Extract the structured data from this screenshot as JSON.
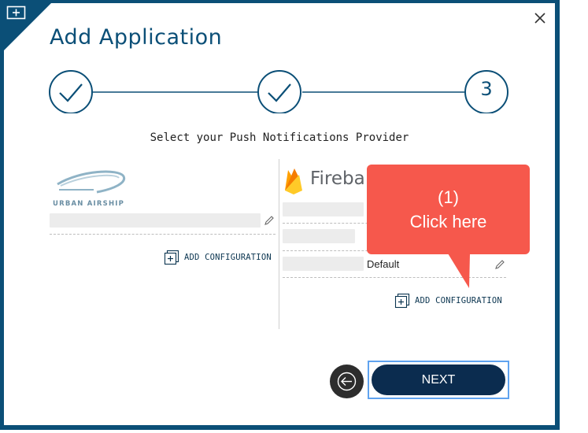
{
  "dialog": {
    "title": "Add Application",
    "close_icon": "close-icon",
    "corner_icon": "new-window-icon"
  },
  "stepper": {
    "steps": [
      {
        "state": "completed",
        "icon": "checkmark-icon"
      },
      {
        "state": "completed",
        "icon": "checkmark-icon"
      },
      {
        "state": "current",
        "label": "3"
      }
    ]
  },
  "subtitle": "Select your Push Notifications Provider",
  "providers": {
    "urban_airship": {
      "logo_text": "URBAN AIRSHIP",
      "add_configuration": "ADD CONFIGURATION"
    },
    "firebase": {
      "logo_text": "Fireba",
      "default_label": "Default",
      "add_configuration": "ADD CONFIGURATION"
    }
  },
  "callout": {
    "line1": "(1)",
    "line2": "Click here"
  },
  "footer": {
    "back_icon": "back-arrow-icon",
    "next_label": "NEXT"
  },
  "colors": {
    "brand": "#0b4f77",
    "callout": "#f6584c",
    "next_button": "#0b2c4f"
  }
}
